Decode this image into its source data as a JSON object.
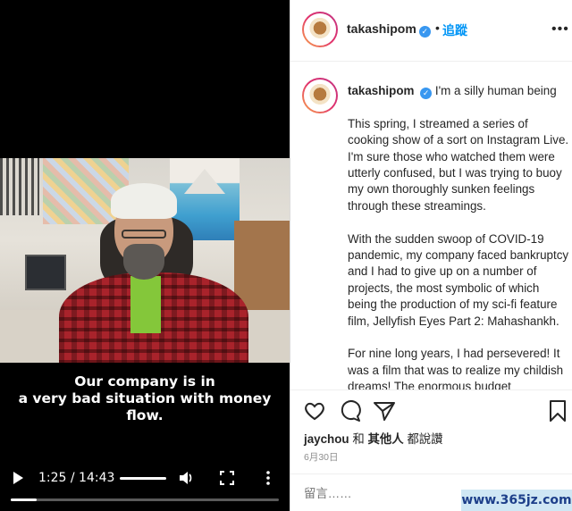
{
  "video": {
    "subtitle_line1": "Our company is in",
    "subtitle_line2": "a very bad situation with money flow.",
    "time": "1:25 / 14:43",
    "progress": 0.097
  },
  "header": {
    "username": "takashipom",
    "separator": "•",
    "follow_label": "追蹤",
    "more_icon": "more-horizontal-icon",
    "verified_mark": "✓"
  },
  "caption": {
    "username": "takashipom",
    "verified_mark": "✓",
    "first_line": "I'm a silly human being",
    "paragraph1": "This spring, I streamed a series of cooking show of a sort on Instagram Live. I'm sure those who watched them were utterly confused, but I was trying to buoy my own thoroughly sunken feelings through these streamings.",
    "paragraph2": "With the sudden swoop of COVID-19 pandemic, my company faced bankruptcy and I had to give up on a number of projects, the most symbolic of which being the production of my sci-fi feature film, Jellyfish Eyes Part 2: Mahashankh.",
    "paragraph3": "For nine long years, I had persevered! It was a film that was to realize my childish dreams! The enormous budget"
  },
  "actions": {
    "icons": [
      "heart-icon",
      "comment-icon",
      "share-icon",
      "bookmark-icon"
    ]
  },
  "likes": {
    "user": "jaychou",
    "and": "和",
    "others": "其他人",
    "suffix": "都說讚"
  },
  "date": "6月30日",
  "comment": {
    "placeholder": "留言……"
  },
  "watermark": "www.365jz.com",
  "colors": {
    "link_blue": "#0095f6",
    "verified_blue": "#3897f0",
    "video_bg": "#000000"
  }
}
